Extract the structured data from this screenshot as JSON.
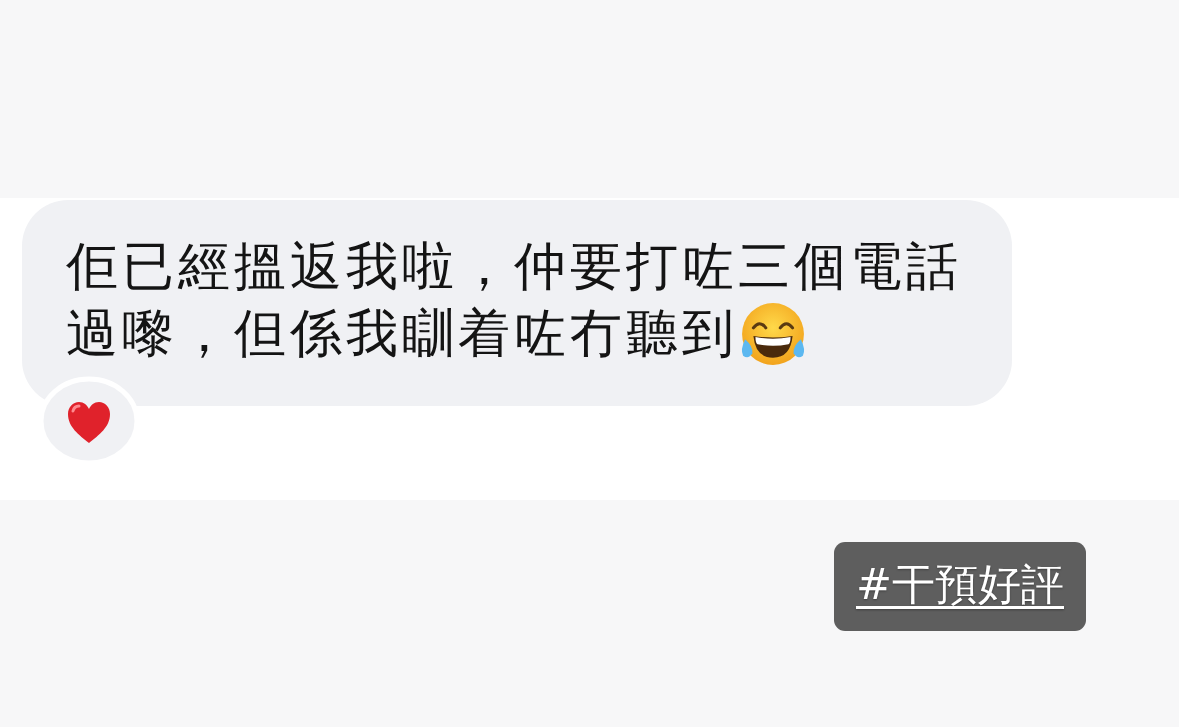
{
  "message": {
    "lines": [
      "佢已經搵返我啦，仲要打咗三個電話",
      "過嚟，但係我瞓着咗冇聽到"
    ]
  },
  "hashtag": {
    "text": "#干預好評"
  }
}
